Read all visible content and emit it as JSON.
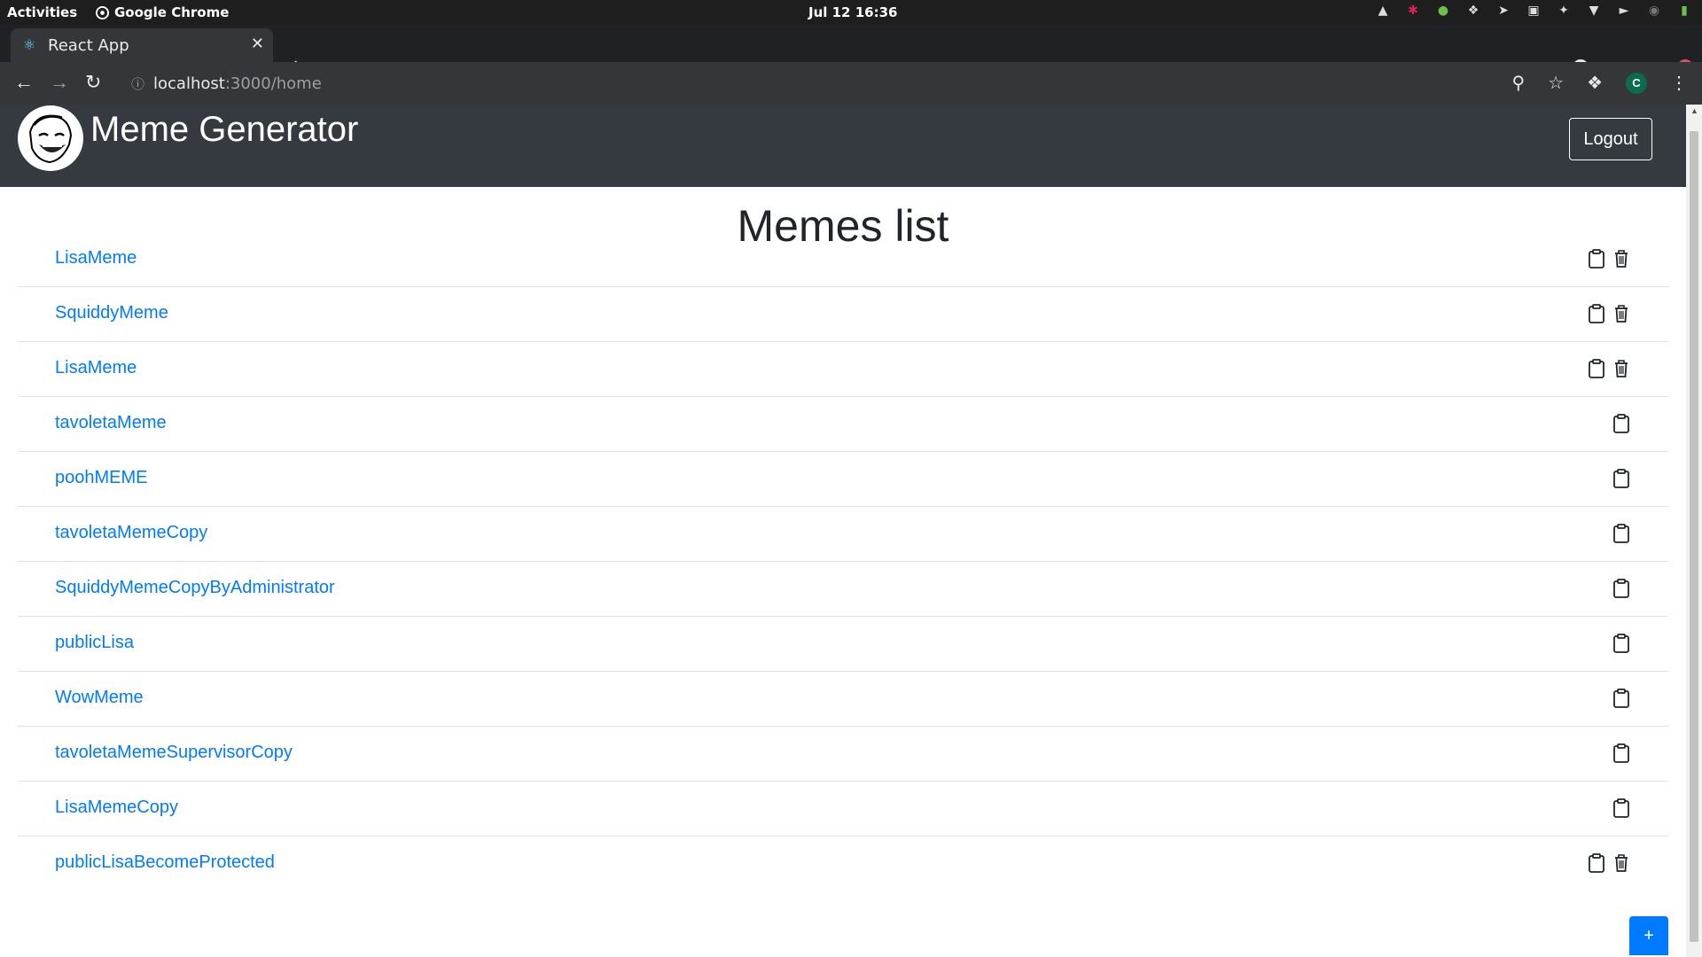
{
  "system": {
    "activities": "Activities",
    "app_name": "Google Chrome",
    "clock": "Jul 12  16:36"
  },
  "browser": {
    "tab_title": "React App",
    "url_host": "localhost",
    "url_path": ":3000/home",
    "profile_initial": "C"
  },
  "app": {
    "brand": "Meme Generator",
    "logout_label": "Logout",
    "heading": "Memes list",
    "add_label": "+"
  },
  "memes": [
    {
      "name": "LisaMeme",
      "deletable": true
    },
    {
      "name": "SquiddyMeme",
      "deletable": true
    },
    {
      "name": "LisaMeme",
      "deletable": true
    },
    {
      "name": "tavoletaMeme",
      "deletable": false
    },
    {
      "name": "poohMEME",
      "deletable": false
    },
    {
      "name": "tavoletaMemeCopy",
      "deletable": false
    },
    {
      "name": "SquiddyMemeCopyByAdministrator",
      "deletable": false
    },
    {
      "name": "publicLisa",
      "deletable": false
    },
    {
      "name": "WowMeme",
      "deletable": false
    },
    {
      "name": "tavoletaMemeSupervisorCopy",
      "deletable": false
    },
    {
      "name": "LisaMemeCopy",
      "deletable": false
    },
    {
      "name": "publicLisaBecomeProtected",
      "deletable": true
    }
  ],
  "colors": {
    "link": "#007bff",
    "navbar": "#343a40",
    "primary_button": "#007bff"
  },
  "icons": {
    "copy": "clipboard-icon",
    "delete": "trash-icon"
  }
}
